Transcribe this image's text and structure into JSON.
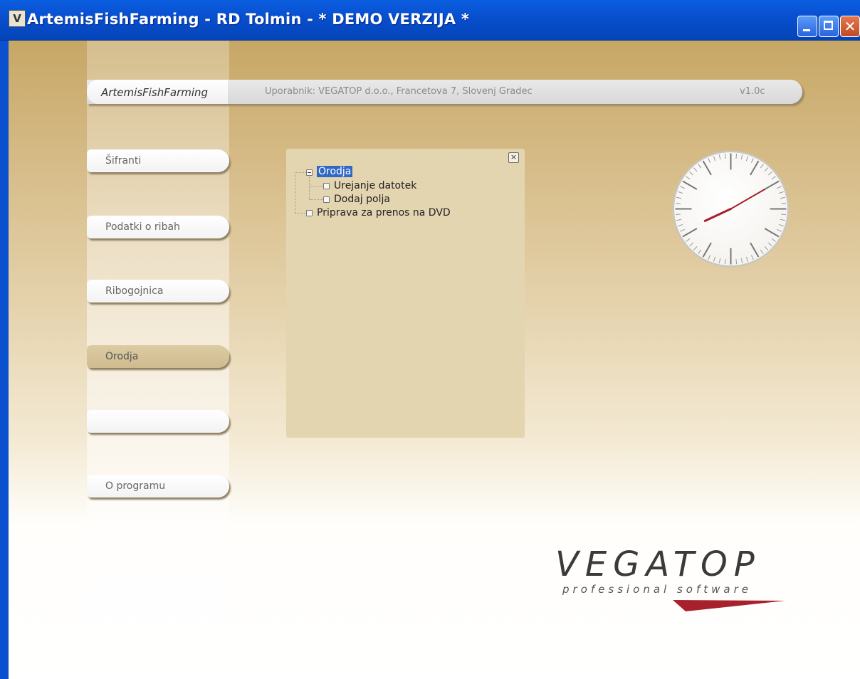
{
  "window": {
    "icon_glyph": "V",
    "title": "ArtemisFishFarming - RD Tolmin - * DEMO VERZIJA *",
    "minimize_glyph": "_",
    "close_glyph": "✕"
  },
  "header": {
    "brand": "ArtemisFishFarming",
    "user": "Uporabnik: VEGATOP d.o.o., Francetova 7, Slovenj Gradec",
    "version": "v1.0c"
  },
  "nav": {
    "items": [
      {
        "label": "Šifranti"
      },
      {
        "label": "Podatki o ribah"
      },
      {
        "label": "Ribogojnica"
      },
      {
        "label": "Orodja",
        "active": true
      },
      {
        "label": ""
      },
      {
        "label": "O programu"
      }
    ]
  },
  "panel": {
    "close_glyph": "×",
    "tree": {
      "root": "Orodja",
      "children": [
        "Urejanje datotek",
        "Dodaj polja"
      ],
      "sibling": "Priprava za prenos na DVD"
    }
  },
  "clock": {
    "hour": 8,
    "minute": 10
  },
  "logo": {
    "name": "VEGATOP",
    "tagline": "professional software"
  },
  "colors": {
    "titlebar": "#0850d0",
    "accent": "#a8202c",
    "panel": "#e4d5b1"
  }
}
